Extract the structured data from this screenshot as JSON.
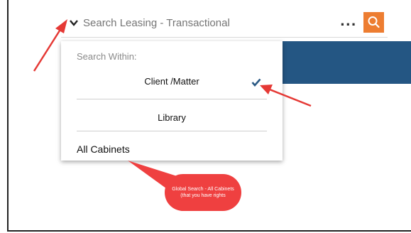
{
  "search": {
    "placeholder": "Search Leasing - Transactional"
  },
  "toolbar": {
    "more_label": "..."
  },
  "dropdown": {
    "header": "Search Within:",
    "options": [
      {
        "label": "Client /Matter",
        "selected": true
      },
      {
        "label": "Library",
        "selected": false
      },
      {
        "label": "All Cabinets",
        "selected": false
      }
    ]
  },
  "callout": {
    "text": "Global Search - All Cabinets (that you have rights"
  },
  "colors": {
    "accent": "#ed7d31",
    "banner": "#245683",
    "check": "#2b5a85",
    "callout": "#ef4040"
  },
  "icons": [
    "chevron-down-icon",
    "search-icon",
    "checkmark-icon"
  ]
}
